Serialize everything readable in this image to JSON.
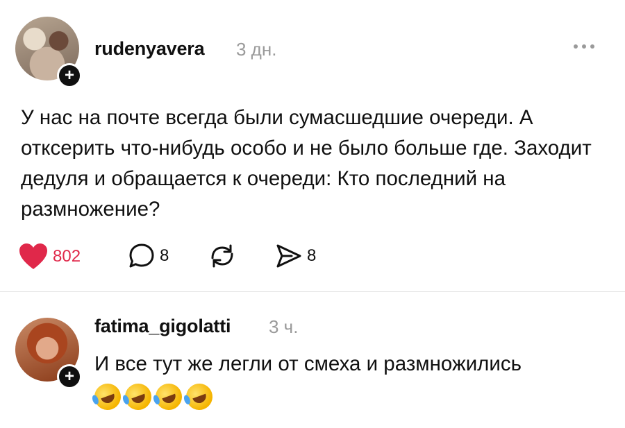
{
  "post": {
    "username": "rudenyavera",
    "time": "3 дн.",
    "text": "У нас на почте всегда были сумасшедшие очереди. А отксерить что-нибудь особо и не было больше где. Заходит дедуля и обращается к очереди: Кто последний на размножение?",
    "likes": "802",
    "comments": "8",
    "shares": "8"
  },
  "reply": {
    "username": "fatima_gigolatti",
    "time": "3 ч.",
    "text": "И все тут же легли от смеха и размножились",
    "emoji_icon": "rolling-on-floor-laughing-emoji",
    "emoji_count": 4
  },
  "colors": {
    "like": "#e0284a",
    "muted": "#9a9a9a",
    "text": "#101010"
  }
}
